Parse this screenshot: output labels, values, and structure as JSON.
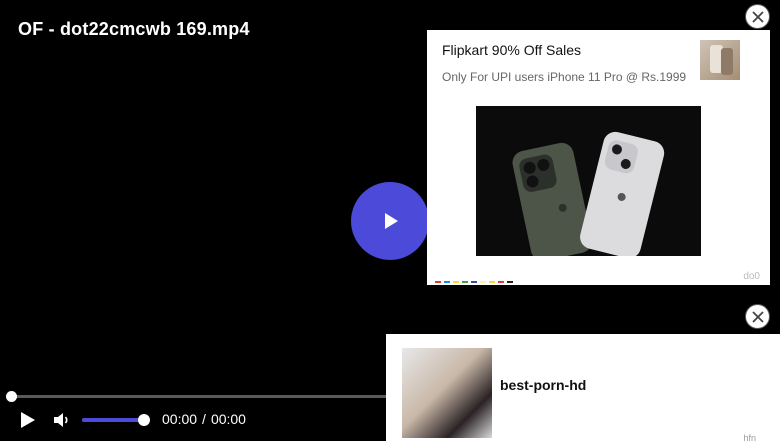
{
  "video": {
    "title": "OF - dot22cmcwb 169.mp4",
    "accent_color": "#4c4ad8",
    "progress_fraction": 0.0,
    "volume_fraction": 1.0,
    "current_time": "00:00",
    "separator": "/",
    "duration": "00:00",
    "icons": [
      "play-icon",
      "volume-icon",
      "zoom-icon",
      "gear-icon",
      "picture-in-picture-icon",
      "cast-icon",
      "fullscreen-icon"
    ]
  },
  "ad_top": {
    "title": "Flipkart 90% Off Sales",
    "subtitle": "Only For UPI users iPhone 11 Pro @ Rs.1999",
    "tag": "do0"
  },
  "ad_bottom": {
    "title": "best-porn-hd",
    "tag": "hfn"
  }
}
